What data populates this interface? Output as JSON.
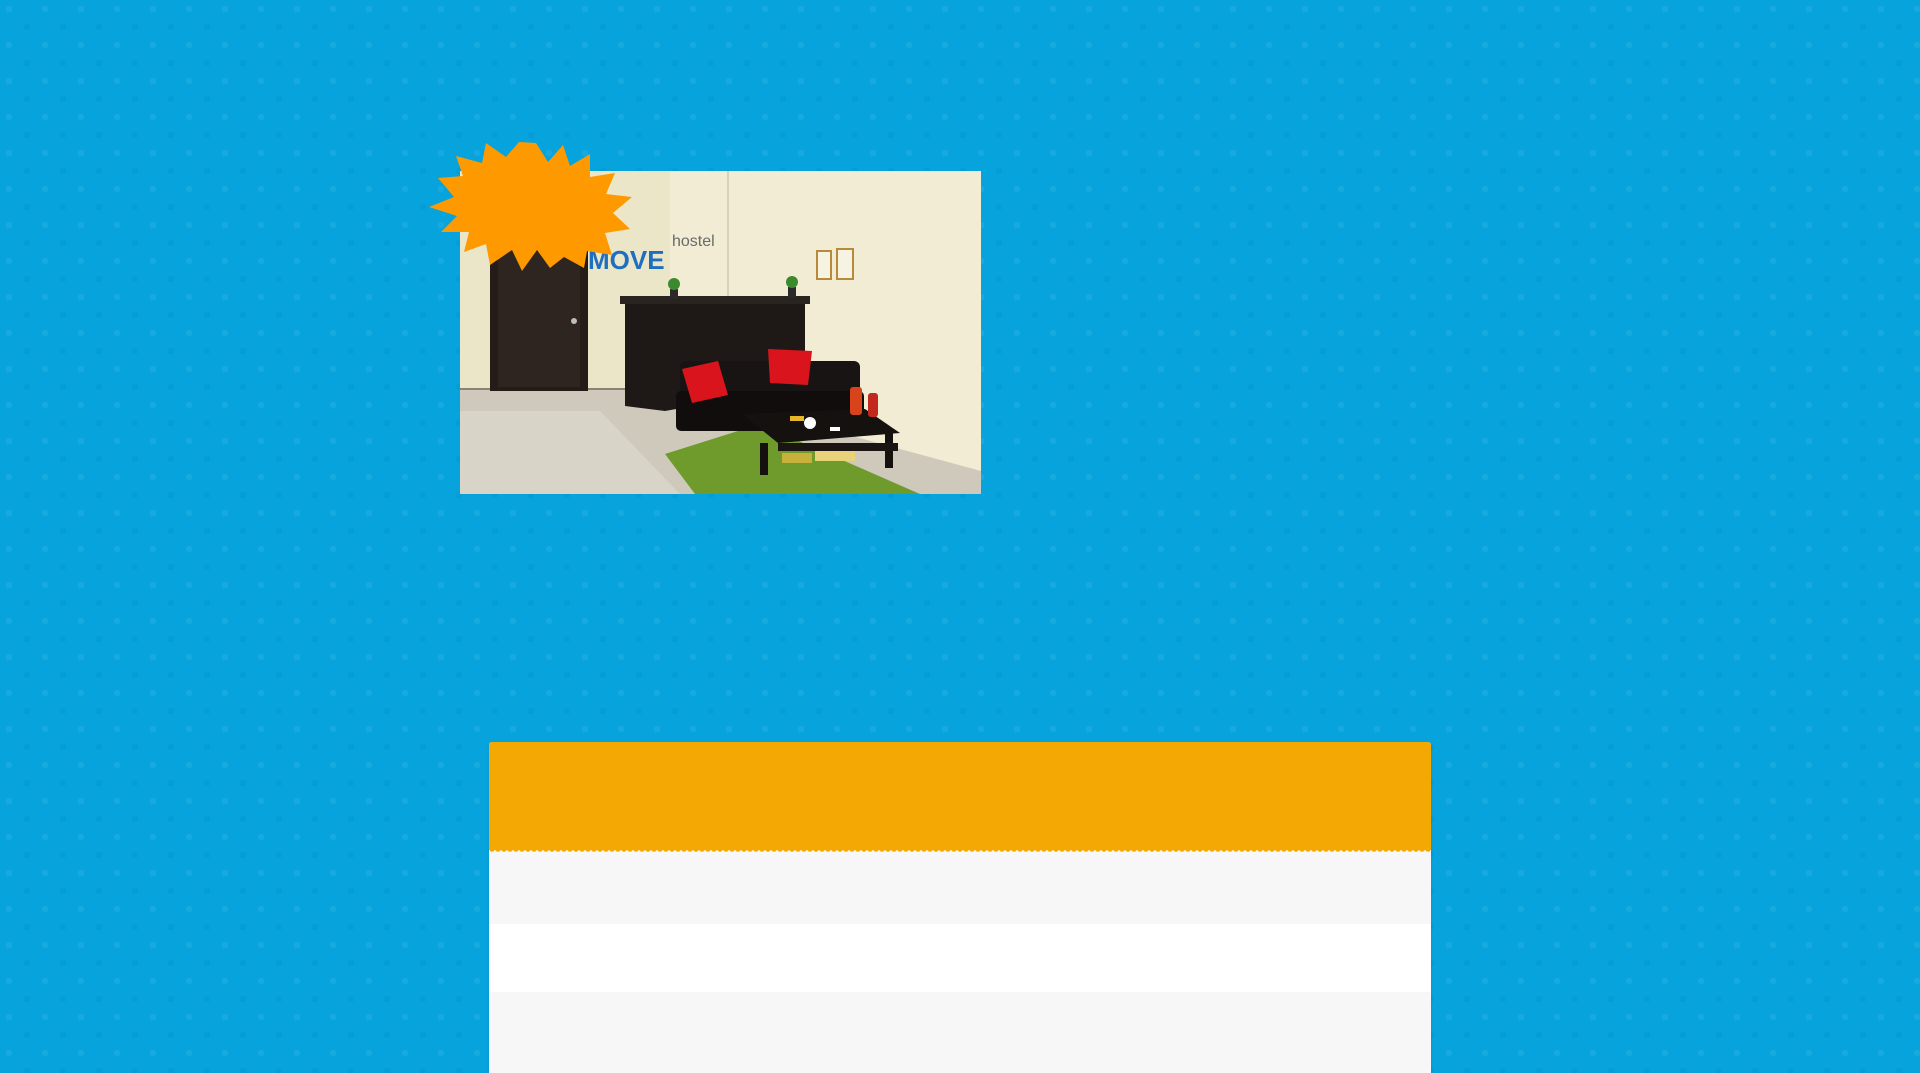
{
  "photo": {
    "logo_primary": "MOVE",
    "logo_secondary": "hostel",
    "colors": {
      "wall": "#ece6c9",
      "floor": "#cfc9bc",
      "furniture": "#1c1816",
      "cushion": "#d9141c",
      "rug": "#6f9a2c",
      "logo_blue": "#1f6fc1",
      "logo_gray": "#6a6a6a"
    }
  },
  "badge": {
    "shape": "starburst",
    "text": "",
    "color": "#ff9900"
  },
  "card": {
    "header_text": "",
    "header_color": "#f4a804",
    "rows": [
      "",
      "",
      ""
    ]
  },
  "theme": {
    "background": "#06a3dc"
  }
}
